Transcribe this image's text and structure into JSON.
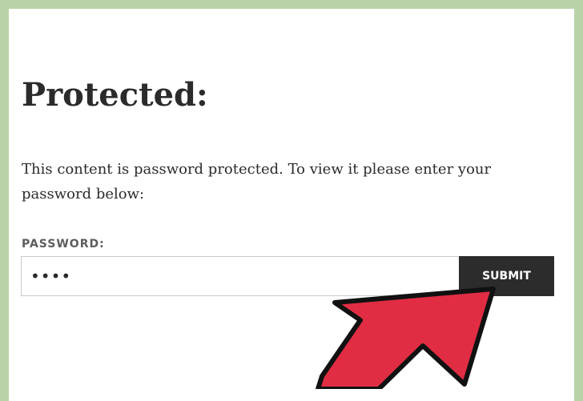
{
  "page": {
    "title": "Protected:",
    "description": "This content is password protected. To view it please enter your password below:"
  },
  "form": {
    "password_label": "PASSWORD:",
    "password_value": "••••",
    "submit_label": "SUBMIT"
  },
  "colors": {
    "frame": "#b9d3a6",
    "arrow_fill": "#e12d44",
    "button_bg": "#2c2c2c"
  },
  "annotation": {
    "arrow_icon": "pointer-arrow-icon"
  }
}
